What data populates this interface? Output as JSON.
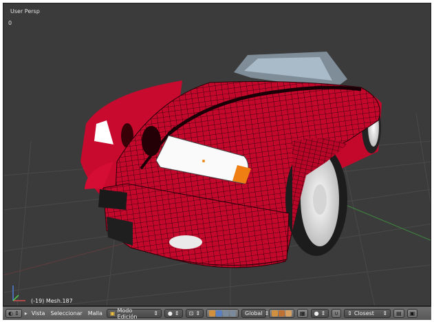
{
  "viewport": {
    "title": "User Persp",
    "counter": "0",
    "object_label": "(-19) Mesh.187"
  },
  "header": {
    "menus": [
      "Vista",
      "Seleccionar",
      "Malla"
    ],
    "mode": "Modo Edición",
    "orientation": "Global",
    "snap_target": "Closest"
  },
  "colors": {
    "viewport_bg": "#3b3b3b",
    "car_body": "#c4082c",
    "wire": "#1a0006",
    "header_bg": "#5e5e5e"
  },
  "icons": [
    "view-menu-icon",
    "mode-icon",
    "shading-sphere-icon",
    "pivot-icon",
    "manipulator-icons",
    "layer-icons",
    "snap-magnet-icon",
    "render-icon"
  ]
}
